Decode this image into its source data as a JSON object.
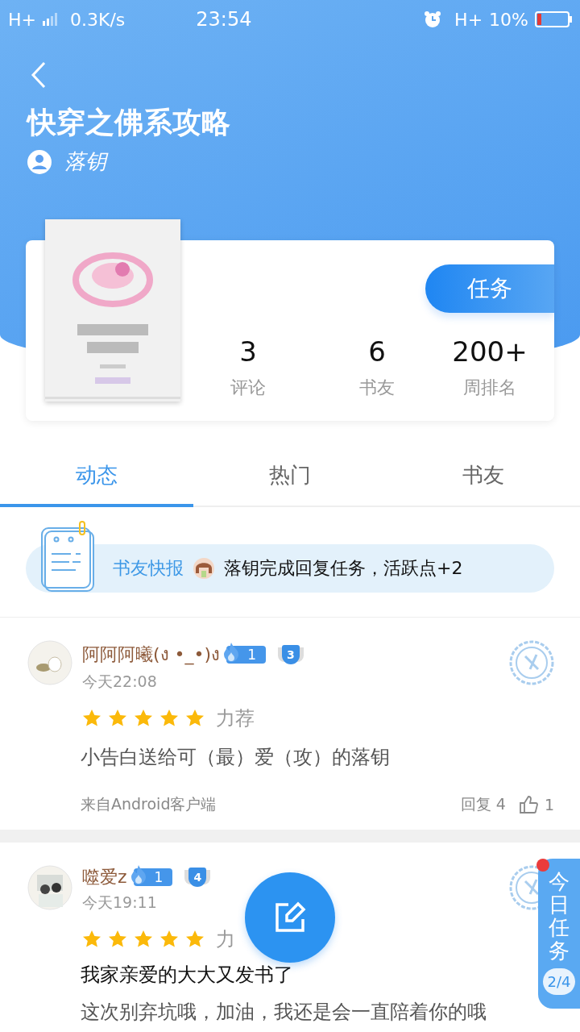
{
  "status_bar": {
    "network": "H+",
    "speed": "0.3K/s",
    "time": "23:54",
    "network_right": "H+",
    "battery": "10%"
  },
  "book": {
    "title": "快穿之佛系攻略",
    "author": "落钥",
    "task_button": "任务",
    "stats": [
      {
        "value": "3",
        "label": "评论"
      },
      {
        "value": "6",
        "label": "书友"
      },
      {
        "value": "200+",
        "label": "周排名"
      }
    ]
  },
  "tabs": [
    {
      "label": "动态",
      "selected": true
    },
    {
      "label": "热门",
      "selected": false
    },
    {
      "label": "书友",
      "selected": false
    }
  ],
  "news": {
    "label": "书友快报",
    "text": "落钥完成回复任务，活跃点+2"
  },
  "comments": [
    {
      "name": "阿阿阿曦(ง •_•)ง",
      "fire_level": "1",
      "medal": "3",
      "time": "今天22:08",
      "stars": 5,
      "tag": "力荐",
      "body": "小告白送给可（最）爱（攻）的落钥",
      "source": "来自Android客户端",
      "reply_label": "回复",
      "replies": "4",
      "likes": "1"
    },
    {
      "name": "噬爱z",
      "fire_level": "1",
      "medal": "4",
      "time": "今天19:11",
      "stars": 5,
      "tag": "力",
      "title": "我家亲爱的大大又发书了",
      "body": "这次别弃坑哦，加油，我还是会一直陪着你的哦"
    }
  ],
  "task_tab": {
    "label": "今日任务",
    "progress": "2/4",
    "has_notification": true
  }
}
